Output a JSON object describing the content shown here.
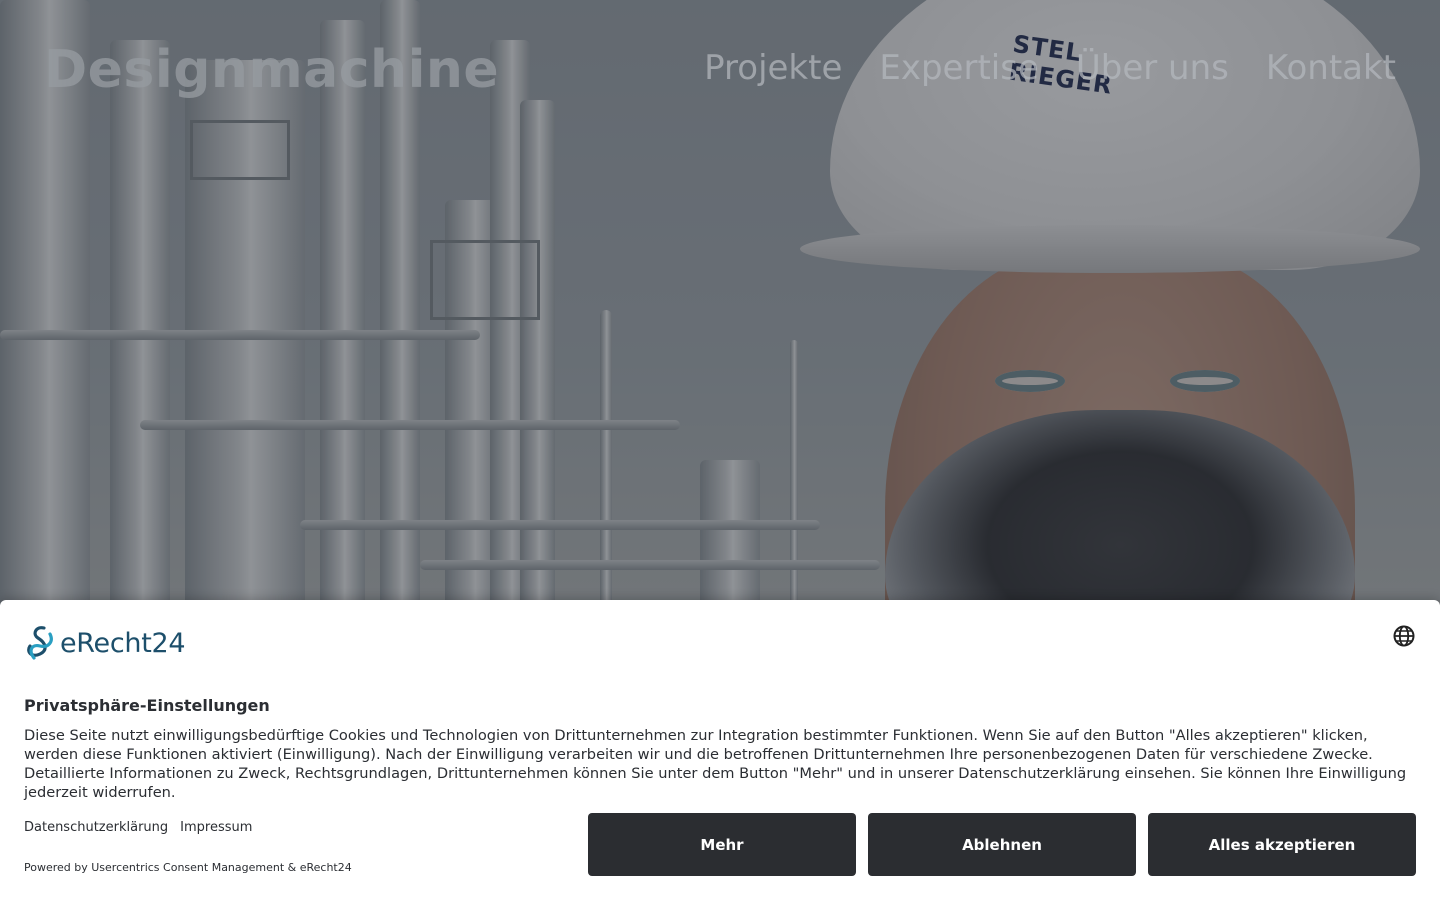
{
  "header": {
    "site_title": "Designmachine",
    "nav": [
      {
        "label": "Projekte"
      },
      {
        "label": "Expertise"
      },
      {
        "label": "Über uns"
      },
      {
        "label": "Kontakt"
      }
    ]
  },
  "hero": {
    "helmet_logo_text": "STEL RIEGER"
  },
  "consent": {
    "brand": "eRecht24",
    "title": "Privatsphäre-Einstellungen",
    "body": "Diese Seite nutzt einwilligungsbedürftige Cookies und Technologien von Drittunternehmen zur Integration bestimmter Funktionen. Wenn Sie auf den Button \"Alles akzeptieren\" klicken, werden diese Funktionen aktiviert (Einwilligung). Nach der Einwilligung verarbeiten wir und die betroffenen Drittunternehmen Ihre personenbezogenen Daten für verschiedene Zwecke. Detaillierte Informationen zu Zweck, Rechtsgrundlagen, Drittunternehmen können Sie unter dem Button \"Mehr\" und in unserer Datenschutzerklärung einsehen. Sie können Ihre Einwilligung jederzeit widerrufen.",
    "links": {
      "privacy": "Datenschutzerklärung",
      "imprint": "Impressum"
    },
    "powered_by": "Powered by Usercentrics Consent Management & eRecht24",
    "buttons": {
      "more": "Mehr",
      "decline": "Ablehnen",
      "accept_all": "Alles akzeptieren"
    },
    "language_icon": "globe-icon"
  },
  "colors": {
    "brand_teal": "#1d4f6b",
    "button_bg": "#2b2d31",
    "overlay": "rgba(40,44,52,0.48)"
  }
}
